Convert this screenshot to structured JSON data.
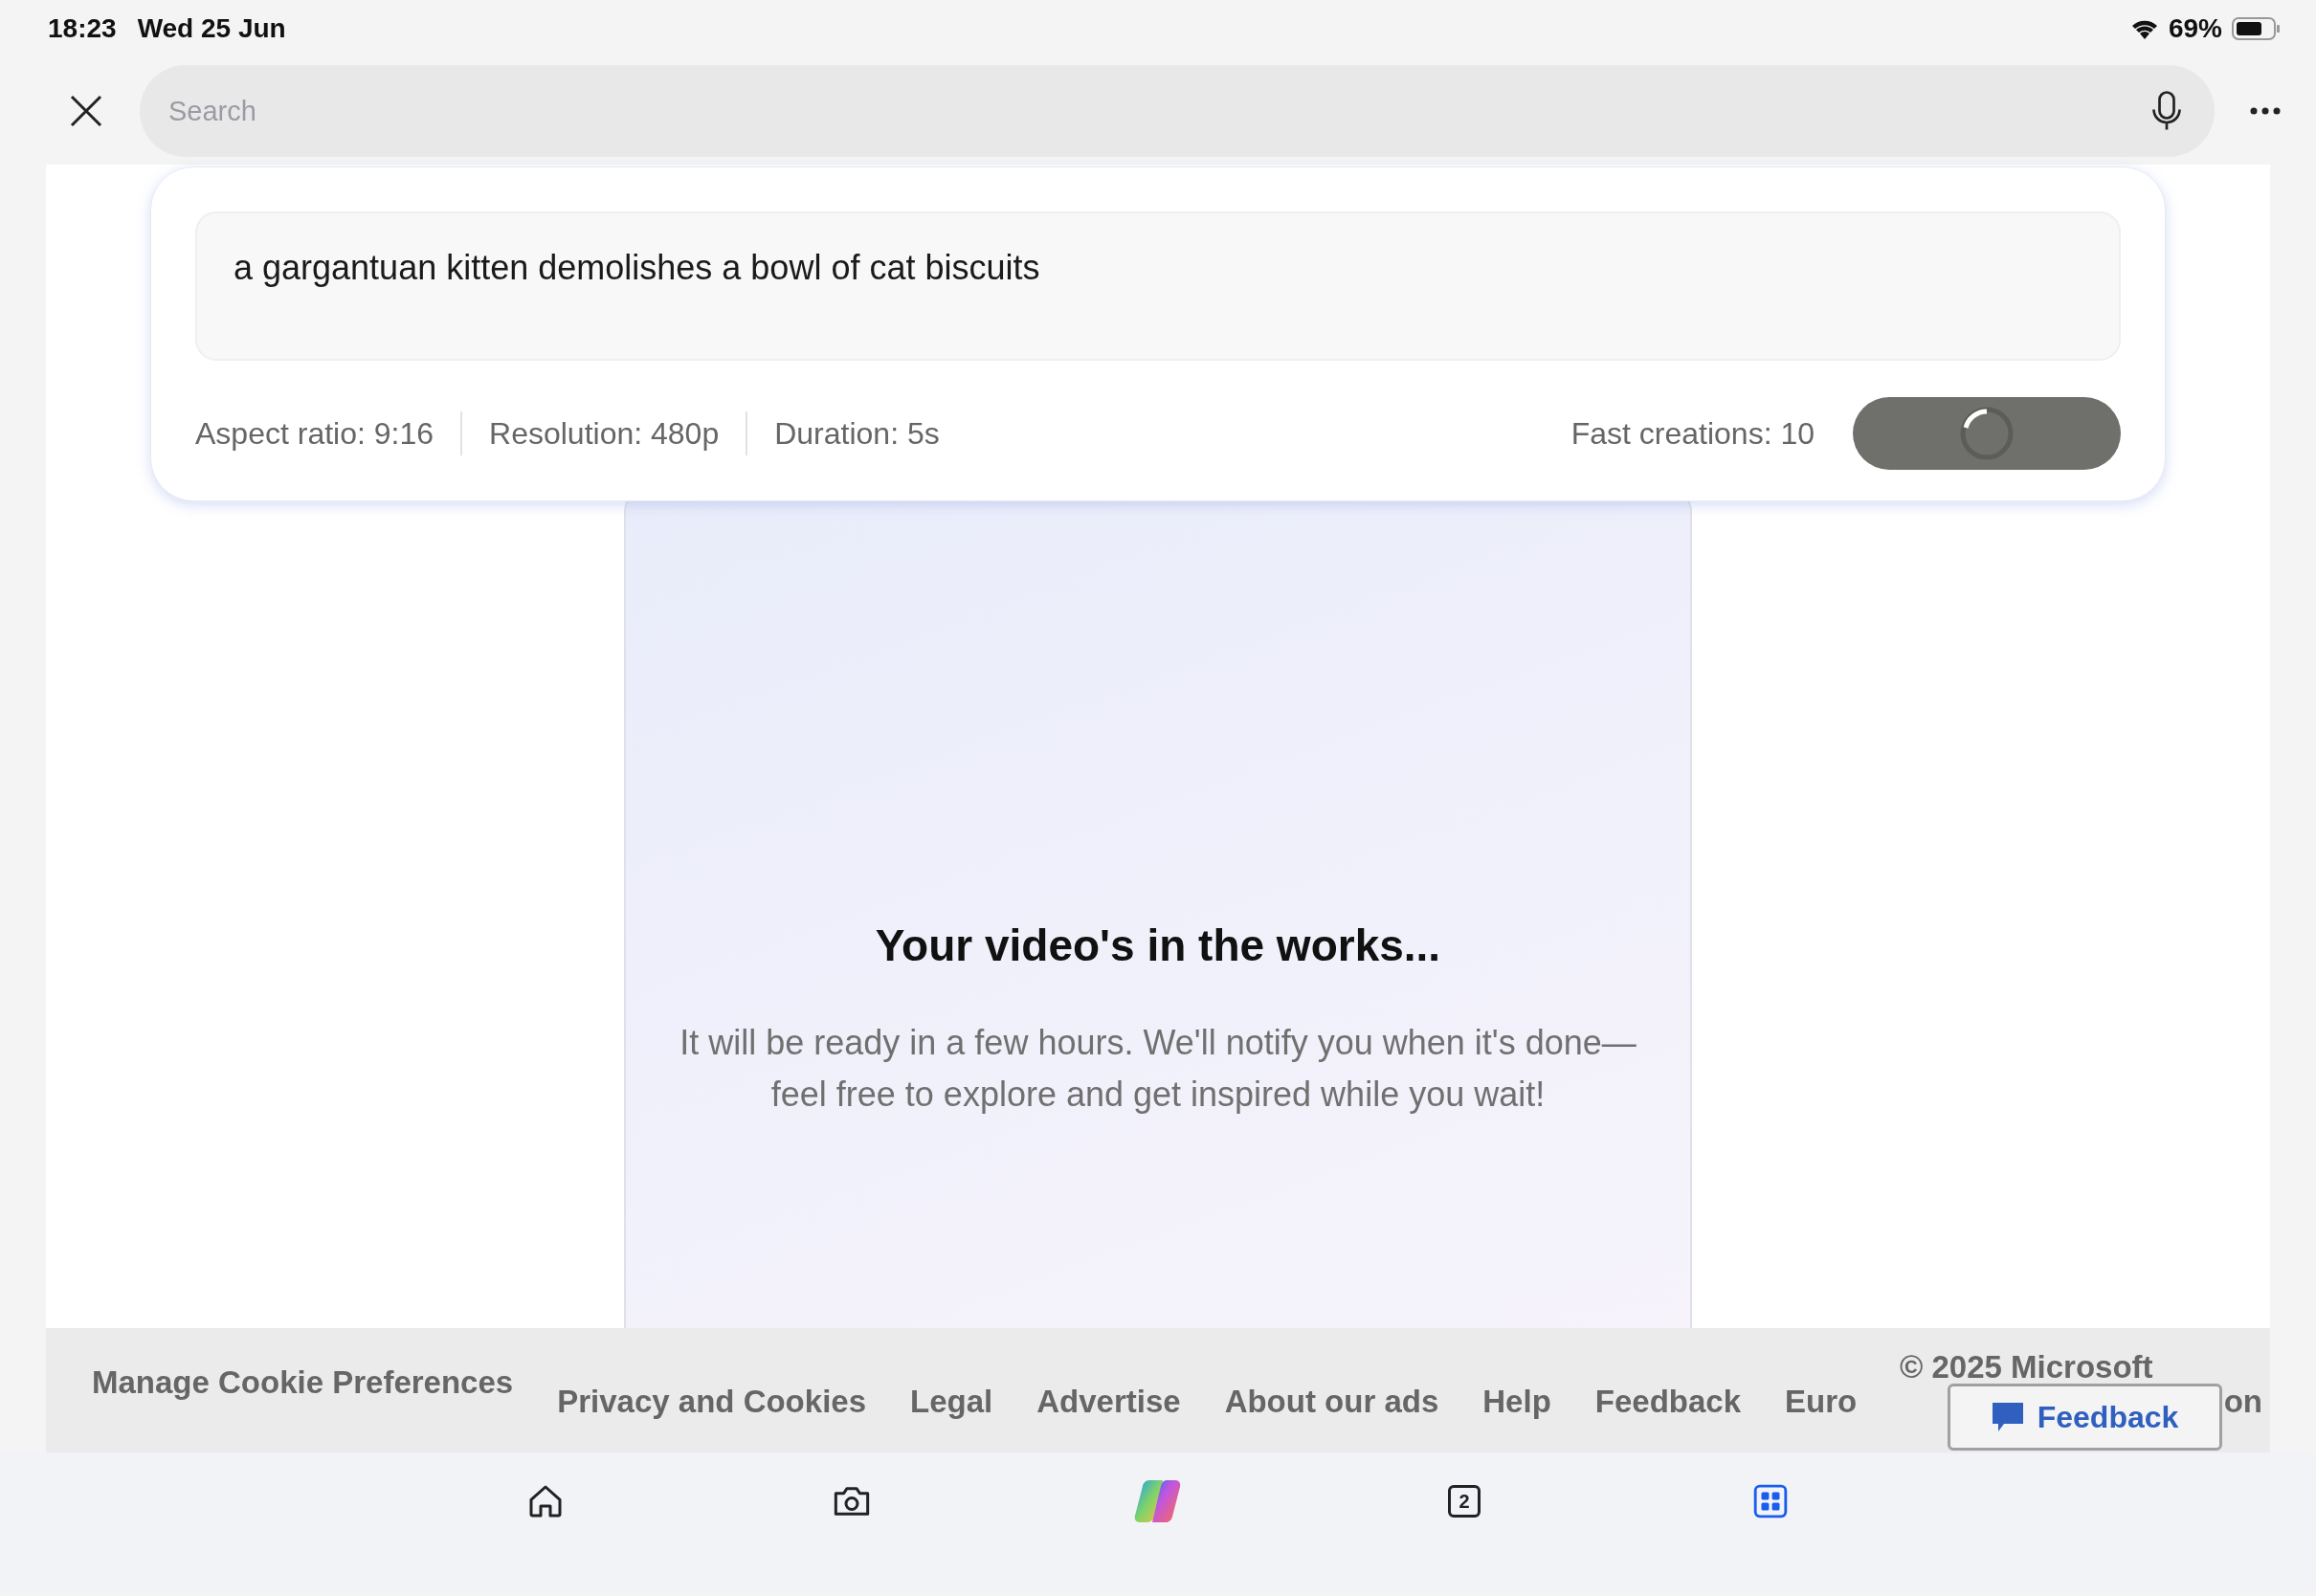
{
  "status_bar": {
    "time": "18:23",
    "date": "Wed 25 Jun",
    "battery": "69%"
  },
  "search": {
    "placeholder": "Search"
  },
  "prompt": {
    "text": "a gargantuan kitten demolishes a bowl of cat biscuits",
    "options": [
      "Aspect ratio: 9:16",
      "Resolution: 480p",
      "Duration: 5s"
    ],
    "credits": "Fast creations: 10",
    "generating": true
  },
  "video_card": {
    "title": "Your video's in the works...",
    "message": "It will be ready in a few hours. We'll notify you when it's done—feel free to explore and get inspired while you wait!"
  },
  "footer": {
    "cookie_link": "Manage Cookie Preferences",
    "links": [
      "Privacy and Cookies",
      "Legal",
      "Advertise",
      "About our ads",
      "Help",
      "Feedback",
      "Euro"
    ],
    "copyright": "© 2025 Microsoft",
    "trailing": "on"
  },
  "feedback_button": {
    "label": "Feedback"
  },
  "bottom_nav": [
    {
      "kind": "home",
      "selected": false
    },
    {
      "kind": "camera",
      "selected": false
    },
    {
      "kind": "copilot",
      "selected": false
    },
    {
      "kind": "tabs",
      "count": "2",
      "selected": false
    },
    {
      "kind": "apps",
      "selected": true
    }
  ]
}
